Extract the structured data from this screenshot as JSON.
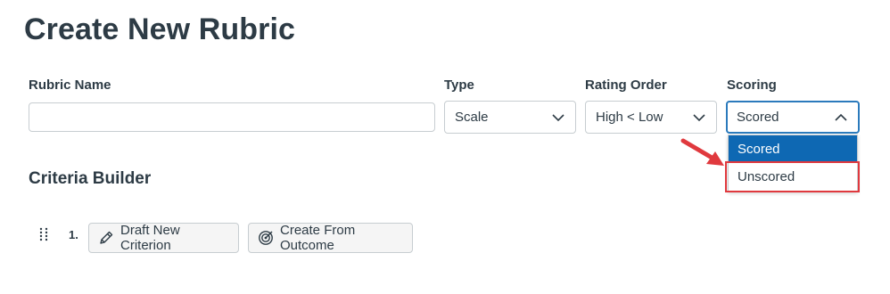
{
  "page": {
    "title": "Create New Rubric"
  },
  "form": {
    "name": {
      "label": "Rubric Name",
      "value": "",
      "placeholder": ""
    },
    "type": {
      "label": "Type",
      "selected": "Scale"
    },
    "rating_order": {
      "label": "Rating Order",
      "selected": "High < Low"
    },
    "scoring": {
      "label": "Scoring",
      "selected": "Scored",
      "options": [
        "Scored",
        "Unscored"
      ],
      "highlighted_option": "Unscored"
    }
  },
  "criteria_builder": {
    "title": "Criteria Builder",
    "row_number": "1.",
    "draft_button_label": "Draft New Criterion",
    "outcome_button_label": "Create From Outcome"
  },
  "icons": {
    "chevron": "chevron-down-icon",
    "chevron_up": "chevron-up-icon",
    "drag": "drag-handle-icon",
    "pencil": "pencil-icon",
    "outcome": "target-icon"
  },
  "colors": {
    "text": "#2d3b45",
    "focus": "#2b7abc",
    "selected_option_bg": "#0e68b3",
    "annotation_red": "#e0393e"
  }
}
